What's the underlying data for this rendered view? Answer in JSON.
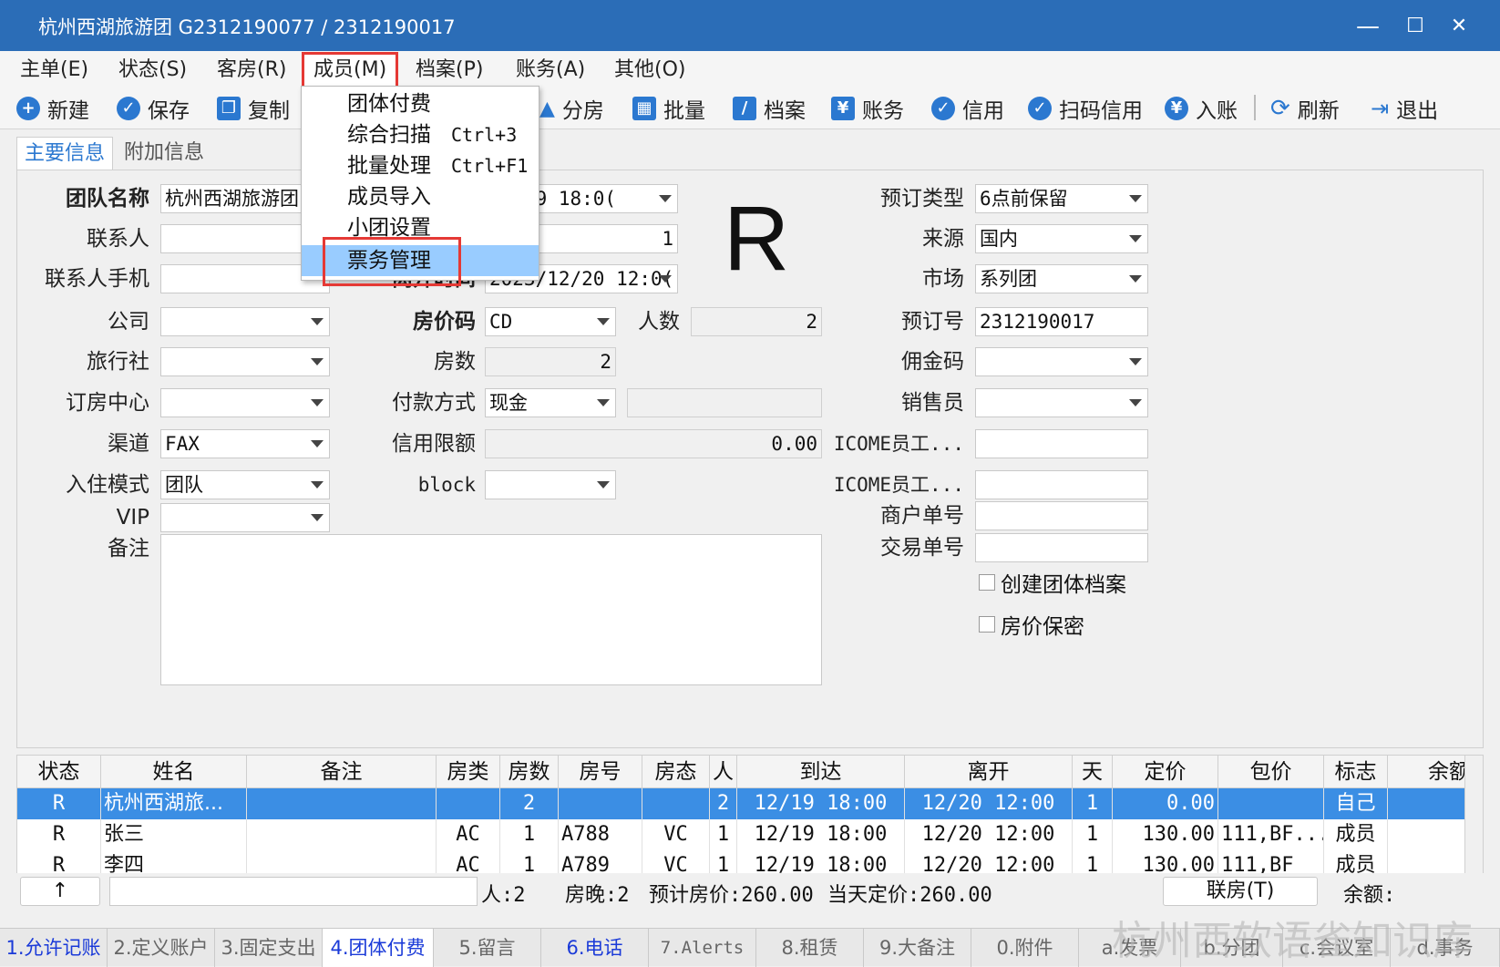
{
  "window": {
    "title": "杭州西湖旅游团  G2312190077  /  2312190017",
    "minimize": "—",
    "maximize": "☐",
    "close": "✕"
  },
  "menubar": [
    "主单(E)",
    "状态(S)",
    "客房(R)",
    "成员(M)",
    "档案(P)",
    "账务(A)",
    "其他(O)"
  ],
  "toolbar": {
    "new": "新建",
    "save": "保存",
    "copy": "复制",
    "split": "分房",
    "batch": "批量",
    "profile": "档案",
    "account": "账务",
    "credit": "信用",
    "scan_credit": "扫码信用",
    "post": "入账",
    "refresh": "刷新",
    "exit": "退出"
  },
  "tabs": {
    "main": "主要信息",
    "extra": "附加信息"
  },
  "dropdown": {
    "items": [
      {
        "label": "团体付费",
        "shortcut": ""
      },
      {
        "label": "综合扫描",
        "shortcut": "Ctrl+3"
      },
      {
        "label": "批量处理",
        "shortcut": "Ctrl+F1"
      },
      {
        "label": "成员导入",
        "shortcut": ""
      },
      {
        "label": "小团设置",
        "shortcut": ""
      },
      {
        "label": "票务管理",
        "shortcut": ""
      }
    ]
  },
  "form": {
    "team_name_label": "团队名称",
    "team_name": "杭州西湖旅游团",
    "contact_label": "联系人",
    "contact": "",
    "contact_phone_label": "联系人手机",
    "contact_phone": "",
    "company_label": "公司",
    "company": "",
    "agency_label": "旅行社",
    "agency": "",
    "center_label": "订房中心",
    "center": "",
    "channel_label": "渠道",
    "channel": "FAX",
    "checkin_mode_label": "入住模式",
    "checkin_mode": "团队",
    "vip_label": "VIP",
    "vip": "",
    "remark_label": "备注",
    "remark": "",
    "arrival": "12/19 18:0(",
    "nights": "1",
    "depart_label": "离开时间",
    "depart": "2023/12/20 12:0(",
    "rate_code_label": "房价码",
    "rate_code": "CD",
    "persons_label": "人数",
    "persons": "2",
    "rooms_label": "房数",
    "rooms": "2",
    "pay_label": "付款方式",
    "pay": "现金",
    "pay_extra": "",
    "credit_label": "信用限额",
    "credit": "0.00",
    "block_label": "block",
    "block": "",
    "status_letter": "R",
    "booking_type_label": "预订类型",
    "booking_type": "6点前保留",
    "source_label": "来源",
    "source": "国内",
    "market_label": "市场",
    "market": "系列团",
    "booking_no_label": "预订号",
    "booking_no": "2312190017",
    "commission_label": "佣金码",
    "commission": "",
    "sales_label": "销售员",
    "sales": "",
    "icome1_label": "ICOME员工...",
    "icome1": "",
    "icome2_label": "ICOME员工...",
    "icome2": "",
    "merchant_label": "商户单号",
    "merchant": "",
    "trade_label": "交易单号",
    "trade": "",
    "create_profile": "创建团体档案",
    "rate_secret": "房价保密"
  },
  "grid": {
    "headers": [
      "状态",
      "姓名",
      "备注",
      "房类",
      "房数",
      "房号",
      "房态",
      "人",
      "到达",
      "离开",
      "天",
      "定价",
      "包价",
      "标志",
      "余额"
    ],
    "rows": [
      [
        "R",
        "杭州西湖旅...",
        "",
        "",
        "2",
        "",
        "",
        "2",
        "12/19 18:00",
        "12/20 12:00",
        "1",
        "0.00",
        "",
        "自己",
        ""
      ],
      [
        "R",
        "张三",
        "",
        "AC",
        "1",
        "A788",
        "VC",
        "1",
        "12/19 18:00",
        "12/20 12:00",
        "1",
        "130.00",
        "111,BF...",
        "成员",
        ""
      ],
      [
        "R",
        "李四",
        "",
        "AC",
        "1",
        "A789",
        "VC",
        "1",
        "12/19 18:00",
        "12/20 12:00",
        "1",
        "130.00",
        "111,BF",
        "成员",
        ""
      ]
    ]
  },
  "summary": {
    "up_button": "↑",
    "persons": "人:2",
    "room_nights": "房晚:2",
    "estimated": "预计房价:260.00",
    "today_rate": "当天定价:260.00",
    "link_room": "联房(T)",
    "balance": "余额:"
  },
  "bottom_tabs": [
    {
      "label": "1.允许记账",
      "color": "blue"
    },
    {
      "label": "2.定义账户",
      "color": "gray"
    },
    {
      "label": "3.固定支出",
      "color": "gray"
    },
    {
      "label": "4.团体付费",
      "color": "blue"
    },
    {
      "label": "5.留言",
      "color": "gray"
    },
    {
      "label": "6.电话",
      "color": "blue"
    },
    {
      "label": "7.Alerts",
      "color": "gray"
    },
    {
      "label": "8.租赁",
      "color": "gray"
    },
    {
      "label": "9.大备注",
      "color": "gray"
    },
    {
      "label": "0.附件",
      "color": "gray"
    },
    {
      "label": "a.发票",
      "color": "gray"
    },
    {
      "label": "b.分团",
      "color": "gray"
    },
    {
      "label": "c.会议室",
      "color": "gray"
    },
    {
      "label": "d.事务",
      "color": "gray"
    }
  ],
  "watermark": "杭州西软语雀知识库",
  "colors": {
    "title_bar": "#2b6db7",
    "highlight": "#99ccff",
    "selected_row": "#3b8ee4",
    "red_box": "#e53935",
    "link_blue": "#1a3ad8"
  }
}
